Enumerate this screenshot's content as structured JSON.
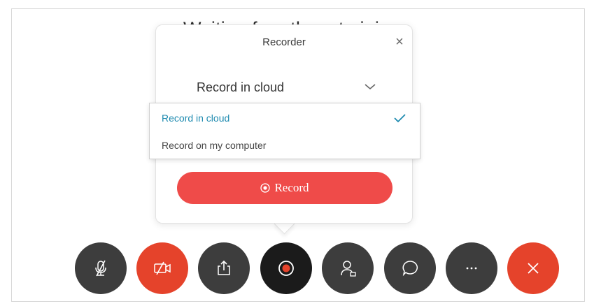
{
  "meeting": {
    "waiting_text": "Waiting for others to join"
  },
  "recorder": {
    "title": "Recorder",
    "close_symbol": "×",
    "selected_option": "Record in cloud",
    "options": [
      {
        "label": "Record in cloud",
        "selected": true
      },
      {
        "label": "Record on my computer",
        "selected": false
      }
    ],
    "record_button_label": "Record"
  },
  "toolbar": {
    "buttons": [
      {
        "icon": "microphone-muted-icon",
        "color": "#3d3d3d"
      },
      {
        "icon": "video-off-icon",
        "color": "#e5432b"
      },
      {
        "icon": "share-icon",
        "color": "#3d3d3d"
      },
      {
        "icon": "record-icon",
        "color": "#1b1b1b"
      },
      {
        "icon": "participants-icon",
        "color": "#3d3d3d"
      },
      {
        "icon": "chat-icon",
        "color": "#3d3d3d"
      },
      {
        "icon": "more-icon",
        "color": "#3d3d3d"
      },
      {
        "icon": "end-call-icon",
        "color": "#e5432b"
      }
    ]
  },
  "colors": {
    "accent_red": "#ef4b49",
    "selected_blue": "#1f8bb0"
  }
}
